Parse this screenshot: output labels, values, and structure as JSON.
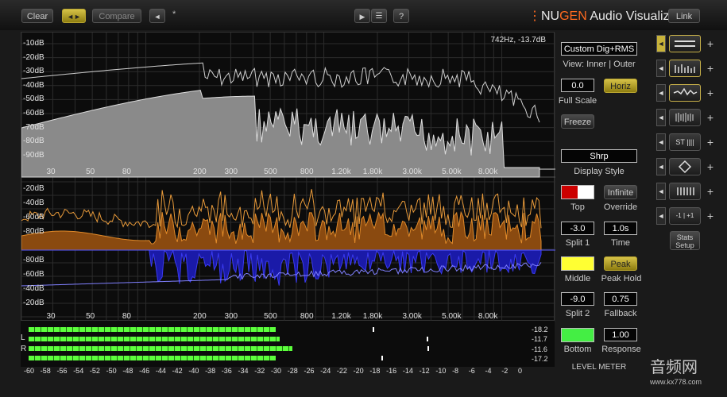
{
  "toolbar": {
    "clear_label": "Clear",
    "compare_label": "Compare",
    "compare_arrows": "◄►",
    "back_arrow": "◄",
    "asterisk": "*",
    "play_icon": "▶",
    "list_icon": "☰",
    "help_label": "?",
    "link_label": "Link"
  },
  "logo": {
    "bar": "⋮",
    "nu": "NU",
    "gen": "GEN",
    "rest": " Audio Visualizer"
  },
  "readout": "742Hz, -13.7dB",
  "top_plot": {
    "y_ticks": [
      "-10dB",
      "-20dB",
      "-30dB",
      "-40dB",
      "-50dB",
      "-60dB",
      "-70dB",
      "-80dB",
      "-90dB"
    ],
    "x_ticks": [
      "30",
      "50",
      "80",
      "200",
      "300",
      "500",
      "800",
      "1.20k",
      "1.80k",
      "3.00k",
      "5.00k",
      "8.00k"
    ]
  },
  "bottom_plot": {
    "y_ticks_top": [
      "-20dB",
      "-40dB",
      "-60dB",
      "-80dB"
    ],
    "y_ticks_bottom": [
      "-80dB",
      "-60dB",
      "-40dB",
      "-20dB"
    ],
    "x_ticks": [
      "30",
      "50",
      "80",
      "200",
      "300",
      "500",
      "800",
      "1.20k",
      "1.80k",
      "3.00k",
      "5.00k",
      "8.00k"
    ]
  },
  "panel": {
    "preset": "Custom Dig+RMS",
    "view_text": "View: Inner | Outer",
    "full_scale_value": "0.0",
    "full_scale_label": "Full Scale",
    "horiz_label": "Horiz",
    "freeze_label": "Freeze",
    "display_style_value": "Shrp",
    "display_style_label": "Display Style",
    "top_label": "Top",
    "top_color": "#cc0000",
    "infinite_label": "Infinite",
    "override_label": "Override",
    "split1_value": "-3.0",
    "split1_label": "Split 1",
    "time_value": "1.0s",
    "time_label": "Time",
    "middle_label": "Middle",
    "middle_color": "#ffff33",
    "peak_label": "Peak",
    "peak_hold_label": "Peak Hold",
    "split2_value": "-9.0",
    "split2_label": "Split 2",
    "fallback_value": "0.75",
    "fallback_label": "Fallback",
    "bottom_label": "Bottom",
    "bottom_color": "#44ee44",
    "response_value": "1.00",
    "response_label": "Response",
    "level_meter_label": "LEVEL METER"
  },
  "strip": {
    "st_label": "ST",
    "lr_label": "-1 | +1",
    "stats_label": "Stats",
    "setup_label": "Setup"
  },
  "meter": {
    "l_label": "L",
    "r_label": "R",
    "values": [
      "-18.2",
      "-11.7",
      "-11.6",
      "-17.2"
    ],
    "bar_levels": [
      -30,
      -29.5,
      -28,
      -30
    ],
    "scale": [
      "-60",
      "-58",
      "-56",
      "-54",
      "-52",
      "-50",
      "-48",
      "-46",
      "-44",
      "-42",
      "-40",
      "-38",
      "-36",
      "-34",
      "-32",
      "-30",
      "-28",
      "-26",
      "-24",
      "-22",
      "-20",
      "-18",
      "-16",
      "-14",
      "-12",
      "-10",
      "-8",
      "-6",
      "-4",
      "-2",
      "0"
    ]
  },
  "watermark": {
    "cn": "音频网",
    "url": "www.kx778.com"
  }
}
